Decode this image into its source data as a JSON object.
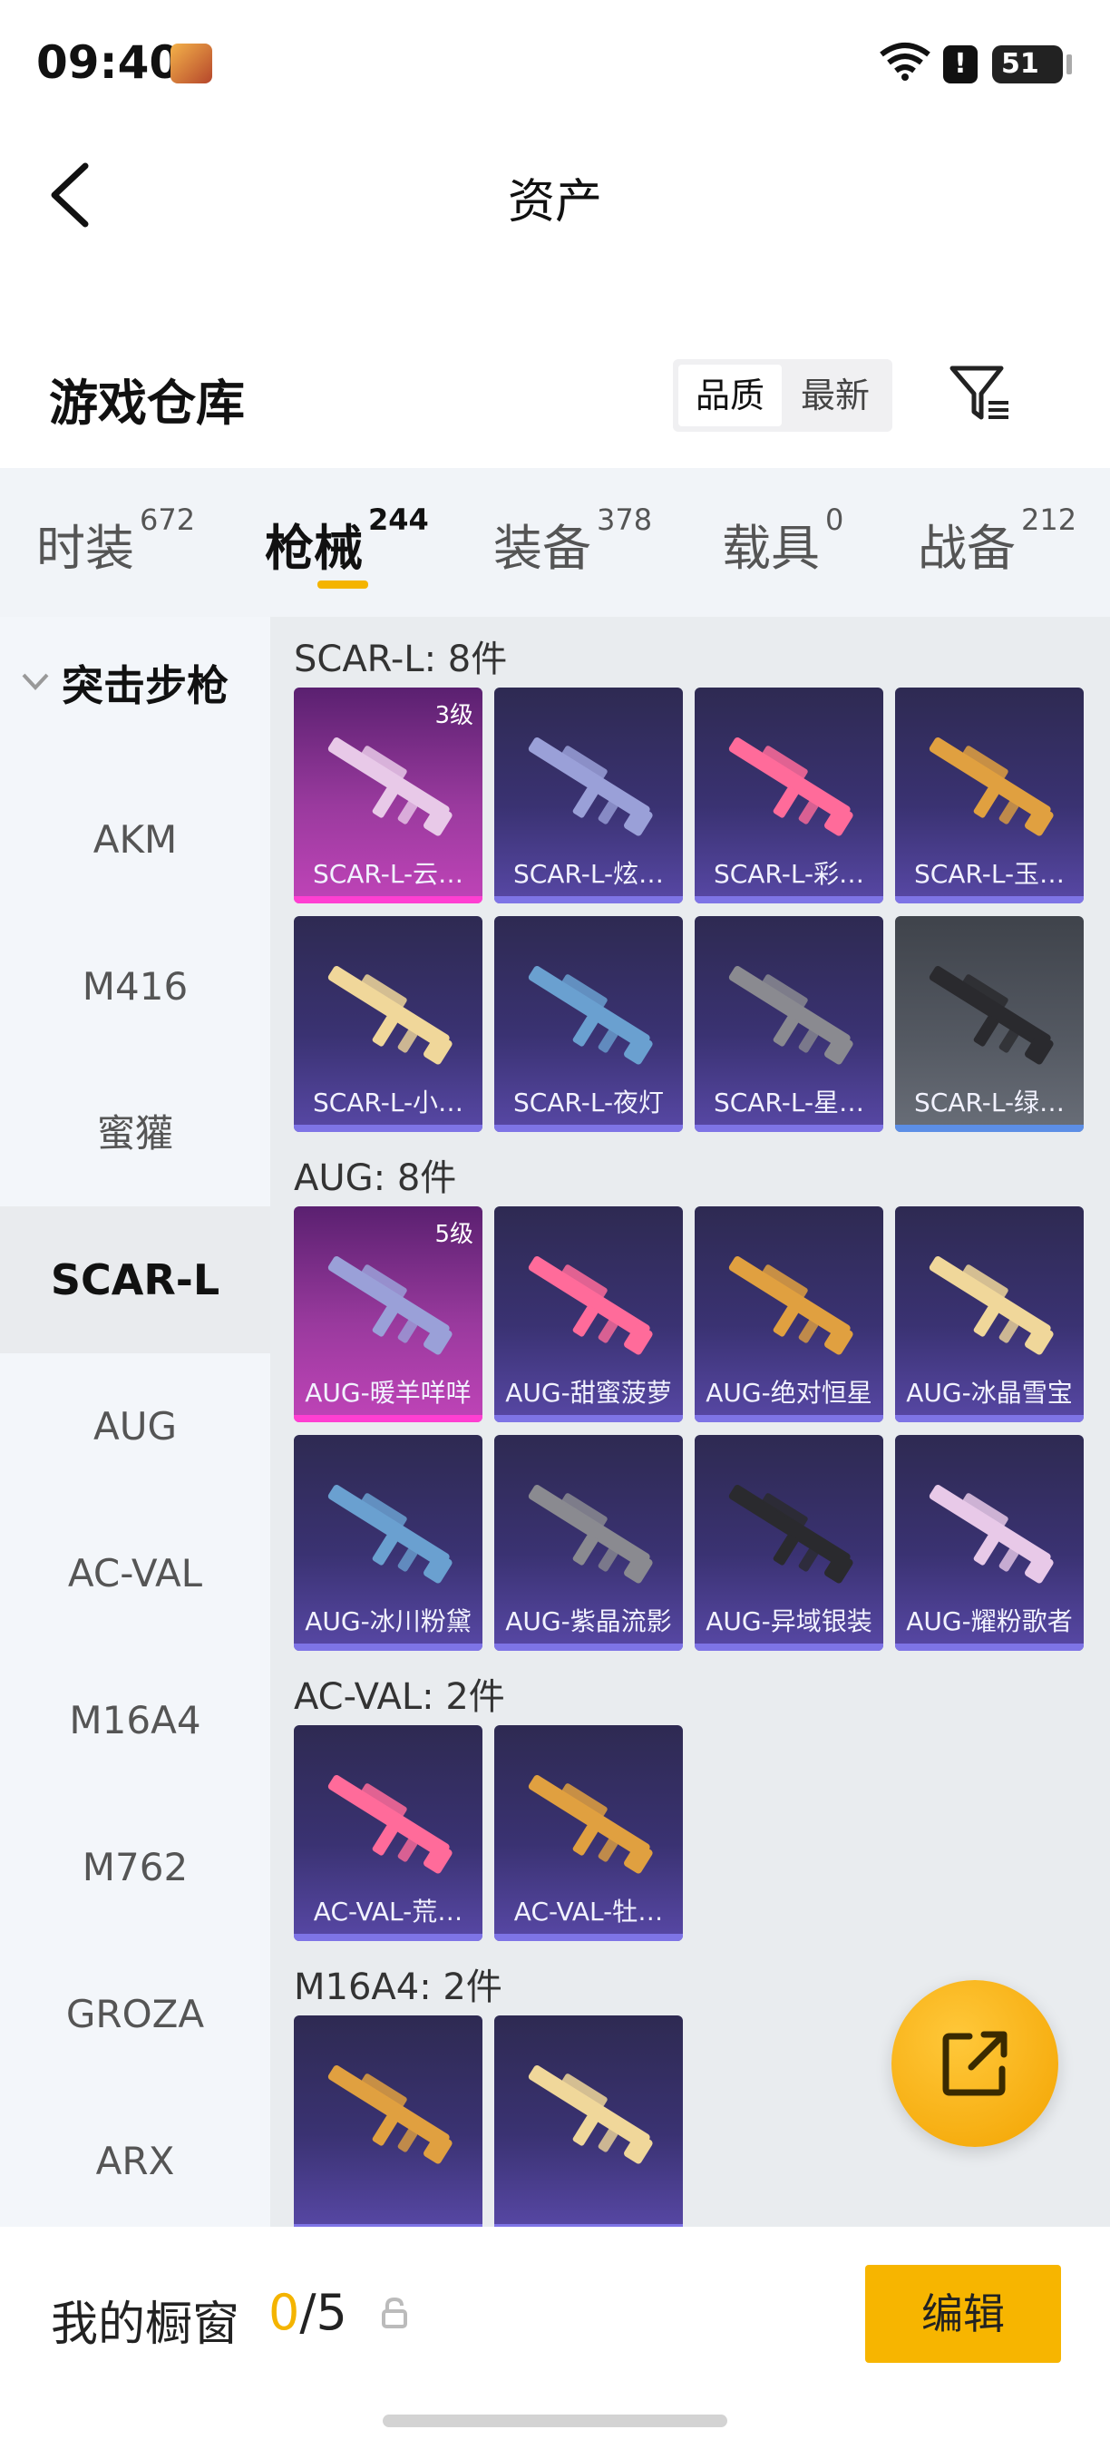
{
  "status_bar": {
    "time": "09:40",
    "battery": "51",
    "alert": "!"
  },
  "header": {
    "title": "资产"
  },
  "warehouse": {
    "title": "游戏仓库",
    "sort_quality": "品质",
    "sort_newest": "最新"
  },
  "tabs": [
    {
      "label": "时装",
      "count": "672"
    },
    {
      "label": "枪械",
      "count": "244"
    },
    {
      "label": "装备",
      "count": "378"
    },
    {
      "label": "载具",
      "count": "0"
    },
    {
      "label": "战备",
      "count": "212"
    }
  ],
  "sidebar": {
    "group": "突击步枪",
    "items": [
      "AKM",
      "M416",
      "蜜獾",
      "SCAR-L",
      "AUG",
      "AC-VAL",
      "M16A4",
      "M762",
      "GROZA",
      "ARX"
    ]
  },
  "groups": [
    {
      "title": "SCAR-L: 8件",
      "items": [
        {
          "name": "SCAR-L-云…",
          "level": "3级",
          "tier": "pink"
        },
        {
          "name": "SCAR-L-炫…",
          "tier": "purple"
        },
        {
          "name": "SCAR-L-彩…",
          "tier": "purple"
        },
        {
          "name": "SCAR-L-玉…",
          "tier": "purple"
        },
        {
          "name": "SCAR-L-小…",
          "tier": "purple"
        },
        {
          "name": "SCAR-L-夜灯",
          "tier": "purple"
        },
        {
          "name": "SCAR-L-星…",
          "tier": "purple"
        },
        {
          "name": "SCAR-L-绿…",
          "tier": "grey"
        }
      ]
    },
    {
      "title": "AUG: 8件",
      "items": [
        {
          "name": "AUG-暖羊咩咩",
          "level": "5级",
          "tier": "pink"
        },
        {
          "name": "AUG-甜蜜菠萝",
          "tier": "purple"
        },
        {
          "name": "AUG-绝对恒星",
          "tier": "purple"
        },
        {
          "name": "AUG-冰晶雪宝",
          "tier": "purple"
        },
        {
          "name": "AUG-冰川粉黛",
          "tier": "purple"
        },
        {
          "name": "AUG-紫晶流影",
          "tier": "purple"
        },
        {
          "name": "AUG-异域银装",
          "tier": "purple"
        },
        {
          "name": "AUG-耀粉歌者",
          "tier": "purple"
        }
      ]
    },
    {
      "title": "AC-VAL: 2件",
      "items": [
        {
          "name": "AC-VAL-荒…",
          "tier": "purple"
        },
        {
          "name": "AC-VAL-牡…",
          "tier": "purple"
        }
      ]
    },
    {
      "title": "M16A4: 2件",
      "items": [
        {
          "name": "",
          "tier": "purple"
        },
        {
          "name": "",
          "tier": "purple"
        }
      ]
    }
  ],
  "bottom": {
    "showcase_label": "我的橱窗",
    "current": "0",
    "total": "/5",
    "edit_label": "编辑"
  },
  "colors": {
    "accent": "#f4b400",
    "pink_tier": "#ff3fd2",
    "purple_tier": "#7e74e6"
  }
}
